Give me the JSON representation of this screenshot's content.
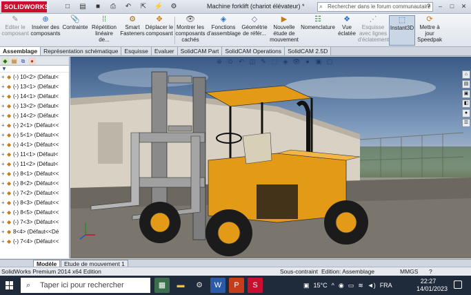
{
  "app": {
    "logo_text": "SOLIDWORKS",
    "window_title": "Machine forklift (chariot élévateur) *",
    "search_placeholder": "Rechercher dans le forum communautaire"
  },
  "ribbon": {
    "buttons": [
      {
        "label": "Editer le composant",
        "icon": "edit-component-icon",
        "enabled": false
      },
      {
        "label": "Insérer des composants",
        "icon": "insert-components-icon",
        "enabled": true
      },
      {
        "label": "Contrainte",
        "icon": "mate-icon",
        "enabled": true
      },
      {
        "label": "Répétition linéaire de...",
        "icon": "linear-pattern-icon",
        "enabled": true
      },
      {
        "label": "Smart Fasteners",
        "icon": "smart-fasteners-icon",
        "enabled": true
      },
      {
        "label": "Déplacer le composant",
        "icon": "move-component-icon",
        "enabled": true
      },
      {
        "label": "Montrer les composants cachés",
        "icon": "show-hidden-icon",
        "enabled": true
      },
      {
        "label": "Fonctions d'assemblage",
        "icon": "assembly-features-icon",
        "enabled": true
      },
      {
        "label": "Géométrie de référ...",
        "icon": "reference-geometry-icon",
        "enabled": true
      },
      {
        "label": "Nouvelle étude de mouvement",
        "icon": "motion-study-icon",
        "enabled": true
      },
      {
        "label": "Nomenclature",
        "icon": "bom-icon",
        "enabled": true
      },
      {
        "label": "Vue éclatée",
        "icon": "exploded-view-icon",
        "enabled": true
      },
      {
        "label": "Esquisse avec lignes d'éclatement",
        "icon": "explode-line-icon",
        "enabled": false
      },
      {
        "label": "Instant3D",
        "icon": "instant3d-icon",
        "enabled": true,
        "active": true
      },
      {
        "label": "Mettre à jour Speedpak",
        "icon": "speedpak-icon",
        "enabled": true
      }
    ]
  },
  "tabs": [
    "Assemblage",
    "Représentation schématique",
    "Esquisse",
    "Evaluer",
    "SolidCAM Part",
    "SolidCAM Operations",
    "SolidCAM 2.5D"
  ],
  "tree": {
    "items": [
      "(-) 10<2> (Défaut<",
      "(-) 13<1> (Défaut<",
      "(-) 14<1> (Défaut<",
      "(-) 13<2> (Défaut<",
      "(-) 14<2> (Défaut<",
      "(-) 2<1> (Défaut<<",
      "(-) 5<1> (Défaut<<",
      "(-) 4<1> (Défaut<<",
      "(-) 11<1> (Défaut<",
      "(-) 11<2> (Défaut<",
      "(-) 8<1> (Défaut<<",
      "(-) 8<2> (Défaut<<",
      "(-) 7<2> (Défaut<<",
      "(-) 8<3> (Défaut<<",
      "(-) 8<5> (Défaut<<",
      "(-) 7<3> (Défaut<<",
      "8<4> (Défaut<<Dé",
      "(-) 7<4> (Défaut<<"
    ]
  },
  "bottom_tabs": [
    "Modèle",
    "Etude de mouvement 1"
  ],
  "status": {
    "edition": "SolidWorks Premium 2014 x64 Edition",
    "constraint": "Sous-contraint",
    "mode": "Edition: Assemblage",
    "units": "MMGS",
    "help": "?"
  },
  "taskbar": {
    "search_placeholder": "Taper ici pour rechercher",
    "temperature": "15°C",
    "language": "FRA",
    "time": "22:27",
    "date": "14/01/2023"
  },
  "colors": {
    "forklift_body": "#e39a16",
    "ribbon_bg": "#e6eaf0",
    "taskbar_bg": "#1f2a3a",
    "logo_red": "#c8102e"
  }
}
